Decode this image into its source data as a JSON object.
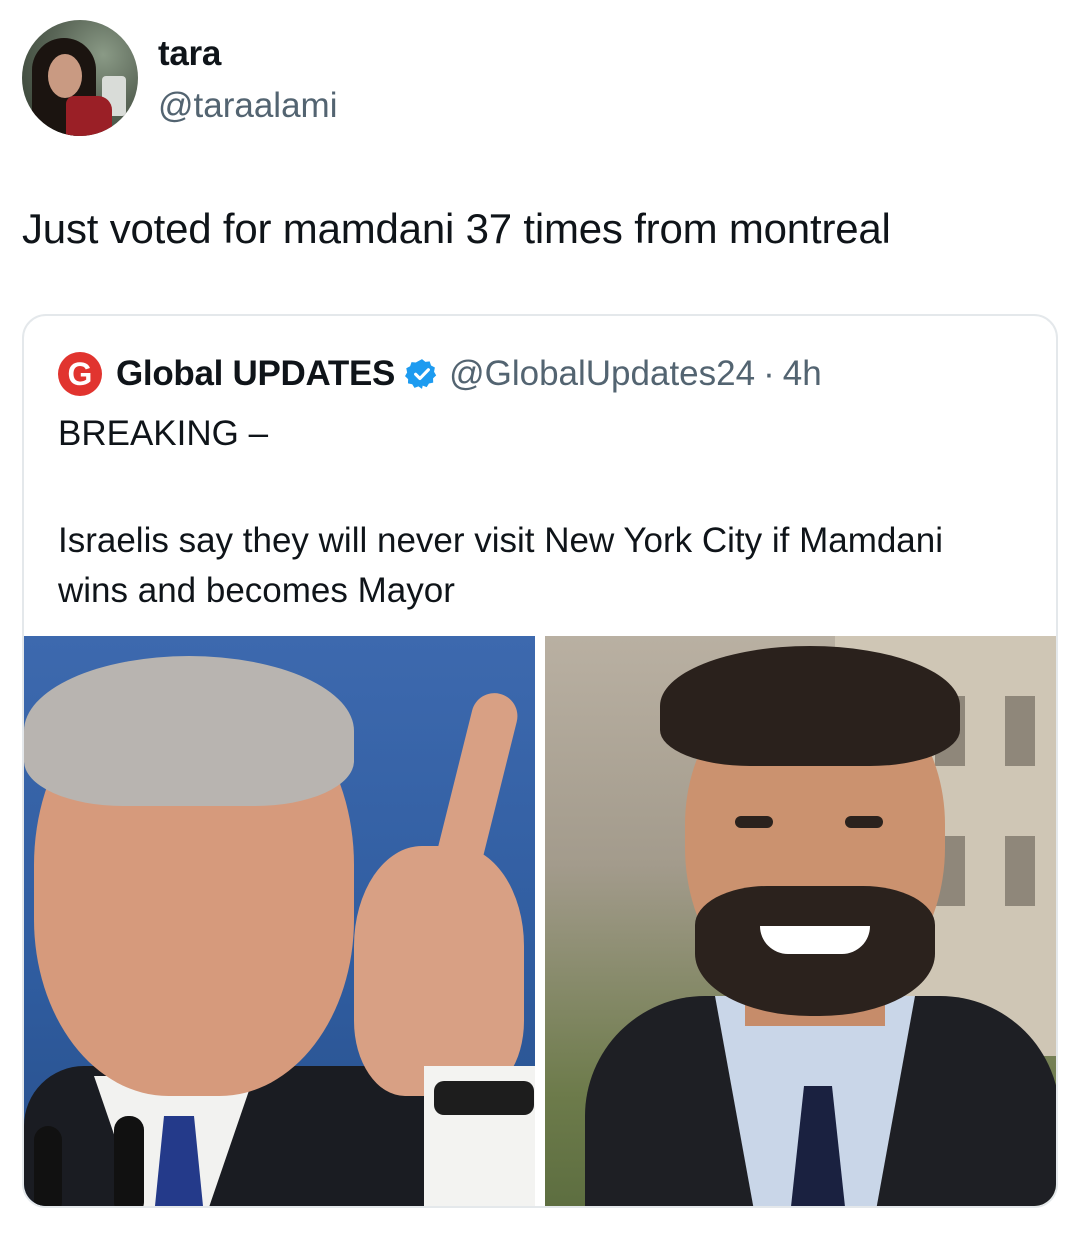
{
  "tweet": {
    "author": {
      "display_name": "tara",
      "handle": "@taraalami",
      "avatar_icon": "profile-photo"
    },
    "text": "Just voted for mamdani 37 times from montreal"
  },
  "quoted_tweet": {
    "logo_letter": "G",
    "logo_color": "#e1342f",
    "author_name": "Global UPDATES",
    "verified_icon": "verified-badge-icon",
    "verified_color": "#1d9bf0",
    "handle": "@GlobalUpdates24",
    "separator": "·",
    "time": "4h",
    "headline": "BREAKING –",
    "body": "Israelis say they will never visit New York City if Mamdani wins and becomes Mayor",
    "images": [
      {
        "alt_icon": "photo-man-pointing"
      },
      {
        "alt_icon": "photo-man-smiling"
      }
    ]
  },
  "colors": {
    "text_primary": "#0f1419",
    "text_secondary": "#536471",
    "border": "#e4e8eb"
  }
}
